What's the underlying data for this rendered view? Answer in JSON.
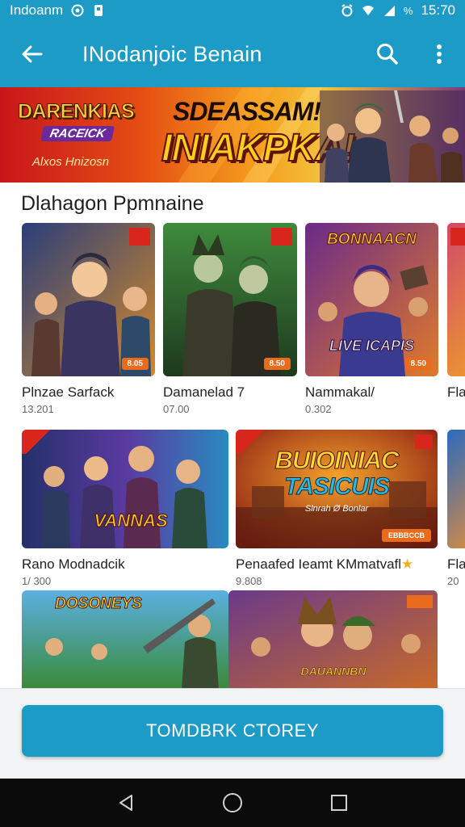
{
  "status_bar": {
    "carrier": "Indoanm",
    "time": "15:70",
    "percent_glyph": "%"
  },
  "app_bar": {
    "title": "INodanjoic Benain",
    "back_icon": "arrow-left-icon",
    "search_icon": "search-icon",
    "more_icon": "more-vertical-icon"
  },
  "banner": {
    "logo_title": "DARENKIAS",
    "logo_subtitle": "RACEICK",
    "tagline": "Alxos Hnizosn",
    "headline_small": "SDEASSAM!",
    "headline_big": "INIAKPKA!"
  },
  "section": {
    "title": "Dlahagon Ppmnaine"
  },
  "row1": [
    {
      "name": "Plnzae Sarfack",
      "sub": "13.201",
      "price": "8.05"
    },
    {
      "name": "Damanelad 7",
      "sub": "07.00",
      "price": "8.50"
    },
    {
      "name": "Nammakal/",
      "sub": "0.302",
      "price": "8.50",
      "overlay_top": "BONNAACN",
      "overlay_bottom": "LIVE ICAPIS"
    },
    {
      "name": "Fla",
      "sub": ""
    }
  ],
  "row2": [
    {
      "name": "Rano Modnadcik",
      "sub": "1/ 300",
      "overlay": "VANNAS"
    },
    {
      "name": "Penaafed Ieamt KMmatvafl",
      "sub": "9.808",
      "overlay_top": "BUIOINIAC",
      "overlay_bottom": "TASICUIS",
      "overlay_small": "Slnrah Ø Bonlar",
      "price": "EBBBCCB"
    },
    {
      "name": "Fla",
      "sub": "20"
    }
  ],
  "row3": [
    {
      "overlay": "DOSONEYS"
    },
    {
      "overlay": "DAUANNBN"
    }
  ],
  "cta": {
    "label": "TOMDBRK CTOREY"
  },
  "nav": {
    "back_icon": "nav-back-icon",
    "home_icon": "nav-home-icon",
    "recents_icon": "nav-recents-icon"
  },
  "colors": {
    "primary": "#1c9bc6",
    "accent": "#e86c1c"
  }
}
